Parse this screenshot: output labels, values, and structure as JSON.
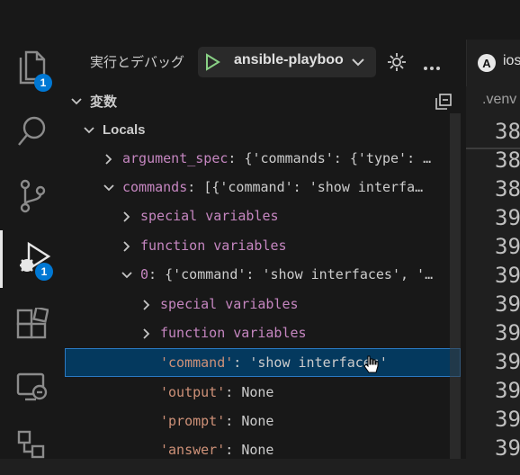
{
  "sidebar": {
    "title": "実行とデバッグ",
    "launch_config": "ansible-playboo",
    "section_title": "変数",
    "scope_title": "Locals"
  },
  "activity_bar": {
    "explorer_badge": "1",
    "debug_badge": "1"
  },
  "variables": [
    {
      "name": "argument_spec",
      "value": "{'commands': {'type': …",
      "expanded": false
    },
    {
      "name": "commands",
      "value": "[{'command': 'show interfa…",
      "expanded": true
    },
    {
      "name": "special variables",
      "value": "",
      "expanded": false
    },
    {
      "name": "function variables",
      "value": "",
      "expanded": false
    },
    {
      "name": "0",
      "value": "{'command': 'show interfaces', '…",
      "expanded": true
    },
    {
      "name": "special variables",
      "value": "",
      "expanded": false
    },
    {
      "name": "function variables",
      "value": "",
      "expanded": false
    },
    {
      "name": "'command'",
      "value": "'show interfaces'",
      "selected": true
    },
    {
      "name": "'output'",
      "value": "None"
    },
    {
      "name": "'prompt'",
      "value": "None"
    },
    {
      "name": "'answer'",
      "value": "None"
    }
  ],
  "editor": {
    "tab_label": "ios",
    "tab_icon_letter": "A",
    "breadcrumb": ".venv",
    "line_numbers": [
      "38",
      "38",
      "38",
      "39",
      "39",
      "39",
      "39",
      "39",
      "39",
      "39",
      "39",
      "39"
    ]
  },
  "colors": {
    "accent": "#0078d4",
    "selection": "#04395e",
    "var_name": "#c586c0",
    "string_value": "#ce9178",
    "play_green": "#89d185"
  }
}
